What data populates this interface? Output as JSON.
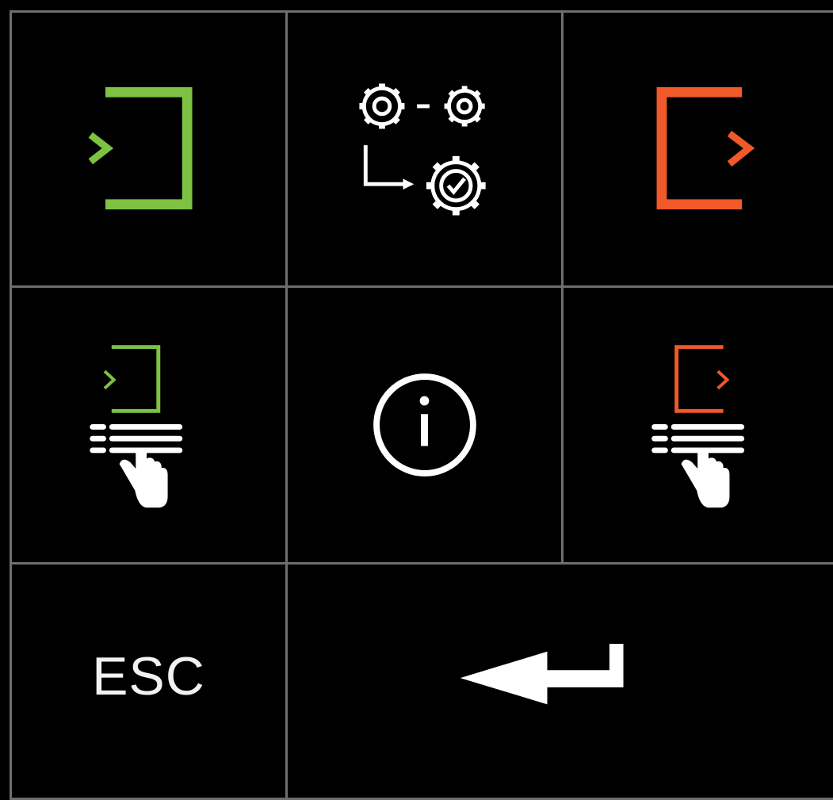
{
  "keypad": {
    "keys": [
      {
        "name": "login-key",
        "icon": "login-icon",
        "color": "#7dc242"
      },
      {
        "name": "process-settings-key",
        "icon": "gears-process-check-icon",
        "color": "#ffffff"
      },
      {
        "name": "logout-key",
        "icon": "logout-icon",
        "color": "#f0592a"
      },
      {
        "name": "manual-login-key",
        "icon": "keypad-login-icon",
        "color": "#7dc242"
      },
      {
        "name": "info-key",
        "icon": "info-icon",
        "color": "#ffffff"
      },
      {
        "name": "manual-logout-key",
        "icon": "keypad-logout-icon",
        "color": "#f0592a"
      },
      {
        "name": "esc-key",
        "label": "ESC"
      },
      {
        "name": "enter-key",
        "icon": "enter-return-icon",
        "color": "#ffffff"
      }
    ],
    "colors": {
      "background": "#000000",
      "grid_lines": "#6e6e6e",
      "green": "#7dc242",
      "orange": "#f0592a",
      "white": "#ffffff"
    }
  }
}
